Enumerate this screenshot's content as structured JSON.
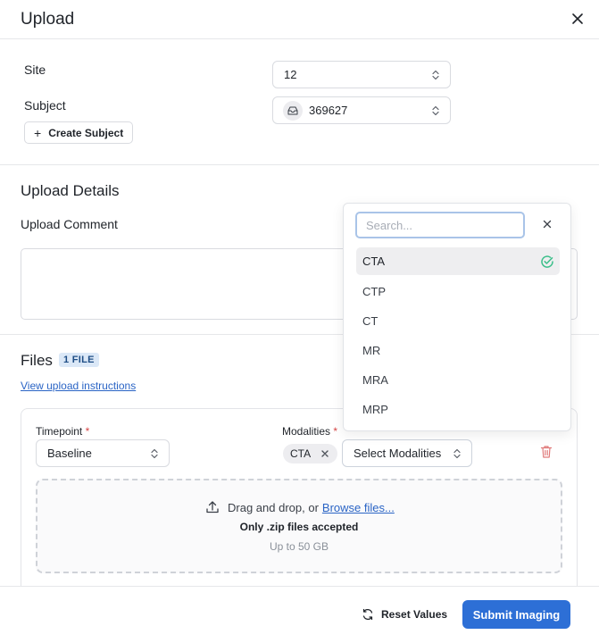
{
  "dialog": {
    "title": "Upload"
  },
  "subject_section": {
    "site_label": "Site",
    "site_value": "12",
    "subject_label": "Subject",
    "subject_value": "369627",
    "create_subject_label": "Create Subject"
  },
  "upload_details": {
    "heading": "Upload Details",
    "comment_label": "Upload Comment",
    "comment_value": ""
  },
  "files": {
    "heading": "Files",
    "count_badge": "1 FILE",
    "instructions_link": "View upload instructions",
    "timepoint_label": "Timepoint",
    "timepoint_value": "Baseline",
    "modalities_label": "Modalities",
    "selected_modality": "CTA",
    "select_modalities_label": "Select Modalities",
    "drop_text": "Drag and drop, or",
    "browse_link": "Browse files...",
    "accepted_text": "Only .zip files accepted",
    "size_limit": "Up to 50 GB"
  },
  "modality_dropdown": {
    "search_placeholder": "Search...",
    "options": [
      "CTA",
      "CTP",
      "CT",
      "MR",
      "MRA",
      "MRP"
    ],
    "selected": "CTA"
  },
  "footer": {
    "reset_label": "Reset Values",
    "submit_label": "Submit Imaging"
  },
  "colors": {
    "primary": "#2d6fd6",
    "required": "#d64545",
    "check": "#3bbf8a",
    "delete": "#e07a7a"
  }
}
